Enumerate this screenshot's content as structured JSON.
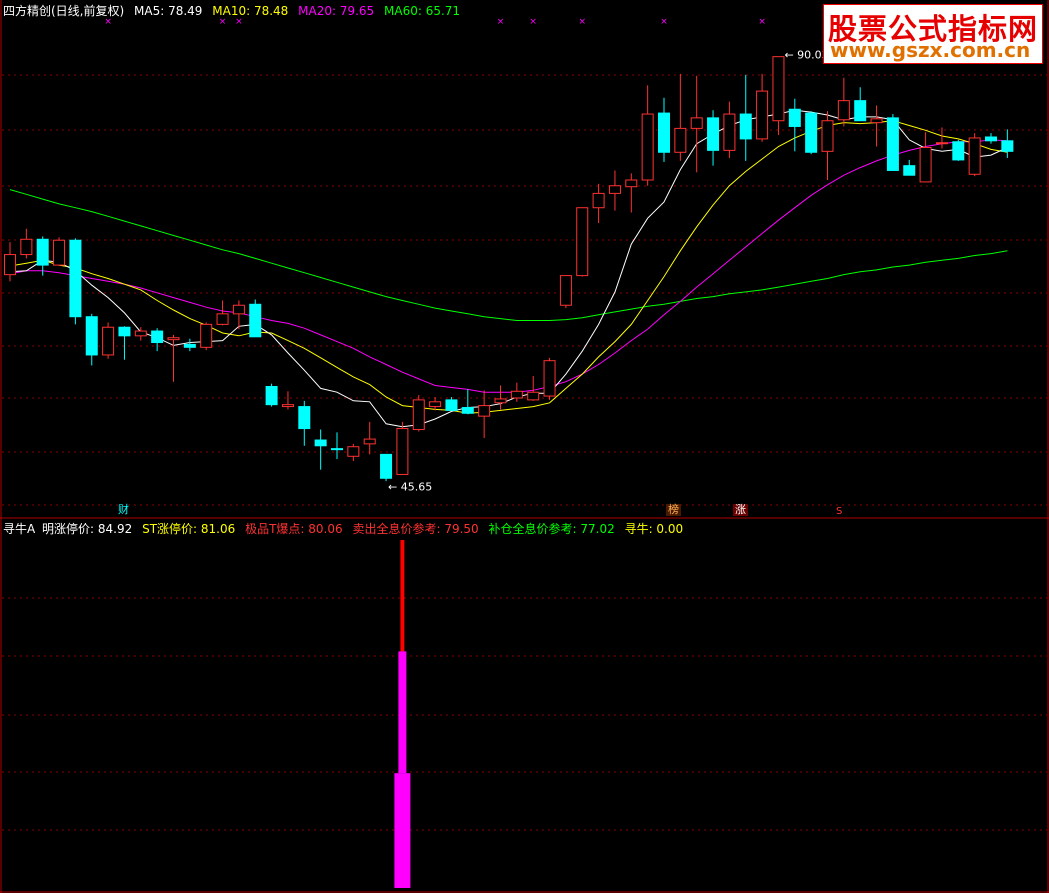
{
  "header": {
    "title": "四方精创(日线,前复权)",
    "ma5": "MA5: 78.49",
    "ma10": "MA10: 78.48",
    "ma20": "MA20: 79.65",
    "ma60": "MA60: 65.71"
  },
  "indicator": {
    "name": "寻牛A",
    "limit_up": "明涨停价: 84.92",
    "st_limit": "ST涨停价: 81.06",
    "t_point": "极品T爆点: 80.06",
    "sell_ref": "卖出全息价参考: 79.50",
    "buy_ref": "补仓全息价参考: 77.02",
    "xunniu": "寻牛: 0.00"
  },
  "annotations": {
    "high": "90.03",
    "low": "45.65"
  },
  "event_tags": {
    "cai": "财",
    "bang": "榜",
    "zhang": "涨",
    "s": "S"
  },
  "watermark": {
    "line1": "股票公式指标网",
    "line2": "www.gszx.com.cn"
  },
  "colors": {
    "up": "#ff3232",
    "down": "#00ffff",
    "ma5": "#ffffff",
    "ma10": "#ffff00",
    "ma20": "#ff00ff",
    "ma60": "#00ff00",
    "grid": "#8b0000",
    "border": "#b00000",
    "bar_red": "#ff0000",
    "bar_magenta": "#ff00ff"
  },
  "chart_data": {
    "type": "candlestick",
    "price_range": [
      43,
      93
    ],
    "candles": [
      [
        67.2,
        70.6,
        66.5,
        69.3
      ],
      [
        69.3,
        72.0,
        68.9,
        70.9
      ],
      [
        70.9,
        71.2,
        67.1,
        68.2
      ],
      [
        68.2,
        71.1,
        68.1,
        70.8
      ],
      [
        70.8,
        71.0,
        62.0,
        62.8
      ],
      [
        62.8,
        63.1,
        57.7,
        58.8
      ],
      [
        58.8,
        62.2,
        58.4,
        61.7
      ],
      [
        61.7,
        61.8,
        58.3,
        60.8
      ],
      [
        60.8,
        61.7,
        60.3,
        61.3
      ],
      [
        61.3,
        61.6,
        59.2,
        60.1
      ],
      [
        60.4,
        60.9,
        56.0,
        60.6
      ],
      [
        59.9,
        60.5,
        59.2,
        59.6
      ],
      [
        59.6,
        62.2,
        59.3,
        62.0
      ],
      [
        62.0,
        64.5,
        61.9,
        63.1
      ],
      [
        63.1,
        64.5,
        61.5,
        64.0
      ],
      [
        64.1,
        64.6,
        61.4,
        60.7
      ],
      [
        55.5,
        55.8,
        53.4,
        53.6
      ],
      [
        53.4,
        55.0,
        53.1,
        53.6
      ],
      [
        53.4,
        54.0,
        49.3,
        51.1
      ],
      [
        49.9,
        51.0,
        46.8,
        49.3
      ],
      [
        49.0,
        50.7,
        47.9,
        48.9
      ],
      [
        48.2,
        49.5,
        47.7,
        49.2
      ],
      [
        49.5,
        51.8,
        48.4,
        50.0
      ],
      [
        48.4,
        48.4,
        45.6,
        45.9
      ],
      [
        46.3,
        51.8,
        46.4,
        51.1
      ],
      [
        51.0,
        54.6,
        50.8,
        54.1
      ],
      [
        53.4,
        54.4,
        53.0,
        53.9
      ],
      [
        54.1,
        54.4,
        53.2,
        53.0
      ],
      [
        53.3,
        55.2,
        52.6,
        52.7
      ],
      [
        52.4,
        55.1,
        50.1,
        53.5
      ],
      [
        53.8,
        55.6,
        53.1,
        54.2
      ],
      [
        54.3,
        55.9,
        53.9,
        55.0
      ],
      [
        54.1,
        56.6,
        54.0,
        54.9
      ],
      [
        54.5,
        58.5,
        54.1,
        58.2
      ],
      [
        64.0,
        66.9,
        63.7,
        67.1
      ],
      [
        67.1,
        74.1,
        67.0,
        74.2
      ],
      [
        74.2,
        76.7,
        72.6,
        75.7
      ],
      [
        75.7,
        78.1,
        73.9,
        76.5
      ],
      [
        76.4,
        77.8,
        73.7,
        77.1
      ],
      [
        77.1,
        87.0,
        76.5,
        84.0
      ],
      [
        84.1,
        85.7,
        79.0,
        80.0
      ],
      [
        80.0,
        88.2,
        79.1,
        82.5
      ],
      [
        82.5,
        88.0,
        77.9,
        83.6
      ],
      [
        83.6,
        84.4,
        78.6,
        80.2
      ],
      [
        80.2,
        85.3,
        79.4,
        84.0
      ],
      [
        84.0,
        88.1,
        79.1,
        81.4
      ],
      [
        81.4,
        88.2,
        81.1,
        86.4
      ],
      [
        83.3,
        88.5,
        81.8,
        90.0
      ],
      [
        84.5,
        85.6,
        80.1,
        82.7
      ],
      [
        84.1,
        84.3,
        79.8,
        80.0
      ],
      [
        80.1,
        84.3,
        77.1,
        83.3
      ],
      [
        83.4,
        87.8,
        82.7,
        85.4
      ],
      [
        85.4,
        86.8,
        84.0,
        83.3
      ],
      [
        83.1,
        84.9,
        80.6,
        83.5
      ],
      [
        83.6,
        84.0,
        78.1,
        78.1
      ],
      [
        78.6,
        79.2,
        77.7,
        77.6
      ],
      [
        76.9,
        82.1,
        77.2,
        80.5
      ],
      [
        81.0,
        82.6,
        80.4,
        81.0
      ],
      [
        81.1,
        81.3,
        79.1,
        79.2
      ],
      [
        77.7,
        82.0,
        77.5,
        81.5
      ],
      [
        81.6,
        82.0,
        80.9,
        81.2
      ],
      [
        81.2,
        82.4,
        79.4,
        80.1
      ]
    ],
    "ma5": [
      67.5,
      67.6,
      68.7,
      68.5,
      67.6,
      66.1,
      64.8,
      63.2,
      61.2,
      60.6,
      59.8,
      60.1,
      60.2,
      60.3,
      61.8,
      62.0,
      60.9,
      59.0,
      57.2,
      55.3,
      54.9,
      54.0,
      53.9,
      51.6,
      51.3,
      51.5,
      52.1,
      52.9,
      53.3,
      53.4,
      53.7,
      54.4,
      54.8,
      54.8,
      56.8,
      59.2,
      62.0,
      65.4,
      70.4,
      73.1,
      74.8,
      78.2,
      80.9,
      81.9,
      82.8,
      83.4,
      83.7,
      84.0,
      84.4,
      84.2,
      83.9,
      83.4,
      83.7,
      83.7,
      83.4,
      81.3,
      80.4,
      80.1,
      80.3,
      79.5,
      79.7,
      80.5
    ],
    "ma10": [
      68.1,
      68.4,
      68.7,
      68.2,
      67.9,
      67.3,
      66.8,
      66.2,
      65.6,
      64.5,
      63.5,
      62.6,
      61.9,
      61.1,
      60.8,
      61.2,
      61.1,
      60.3,
      59.5,
      58.5,
      57.5,
      56.5,
      55.7,
      54.4,
      53.5,
      53.3,
      53.1,
      53.0,
      52.7,
      52.8,
      53.0,
      53.2,
      53.4,
      53.8,
      55.3,
      56.8,
      58.6,
      60.2,
      62.0,
      64.5,
      67.0,
      69.7,
      72.2,
      74.5,
      76.5,
      78.0,
      79.3,
      80.6,
      81.5,
      82.2,
      82.8,
      83.1,
      83.0,
      83.1,
      83.3,
      82.8,
      82.3,
      81.7,
      81.4,
      80.9,
      80.3,
      80.0
    ],
    "ma20": [
      67.3,
      67.6,
      67.6,
      67.4,
      67.1,
      66.8,
      66.5,
      66.2,
      65.8,
      65.3,
      64.8,
      64.3,
      63.8,
      63.4,
      63.2,
      62.8,
      62.4,
      62.1,
      61.6,
      60.9,
      60.2,
      59.5,
      58.6,
      57.8,
      57.0,
      56.3,
      55.6,
      55.4,
      55.2,
      54.9,
      54.9,
      54.9,
      55.1,
      55.5,
      56.0,
      56.8,
      57.8,
      59.0,
      60.3,
      61.5,
      63.0,
      64.4,
      65.9,
      67.3,
      68.7,
      70.1,
      71.5,
      72.9,
      74.2,
      75.5,
      76.6,
      77.6,
      78.4,
      79.1,
      79.7,
      80.2,
      80.6,
      80.9,
      81.1,
      81.1,
      81.3,
      81.2
    ],
    "ma60": [
      76.1,
      75.6,
      75.1,
      74.6,
      74.2,
      73.8,
      73.3,
      72.8,
      72.3,
      71.8,
      71.3,
      70.8,
      70.3,
      69.8,
      69.4,
      68.9,
      68.4,
      67.9,
      67.4,
      66.9,
      66.4,
      65.9,
      65.4,
      64.9,
      64.5,
      64.1,
      63.7,
      63.4,
      63.1,
      62.8,
      62.6,
      62.4,
      62.4,
      62.4,
      62.5,
      62.7,
      63.0,
      63.3,
      63.6,
      63.9,
      64.1,
      64.4,
      64.7,
      64.9,
      65.2,
      65.4,
      65.6,
      65.9,
      66.2,
      66.5,
      66.8,
      67.2,
      67.5,
      67.7,
      68.0,
      68.2,
      68.5,
      68.7,
      68.9,
      69.2,
      69.4,
      69.7
    ],
    "indicator_bars": {
      "index": 24,
      "red_value": 100,
      "magenta_value": 68,
      "magenta_wide_value": 33,
      "range": [
        0,
        100
      ]
    },
    "top_markers": [
      6,
      13,
      14,
      30,
      32,
      35,
      40,
      46
    ]
  }
}
